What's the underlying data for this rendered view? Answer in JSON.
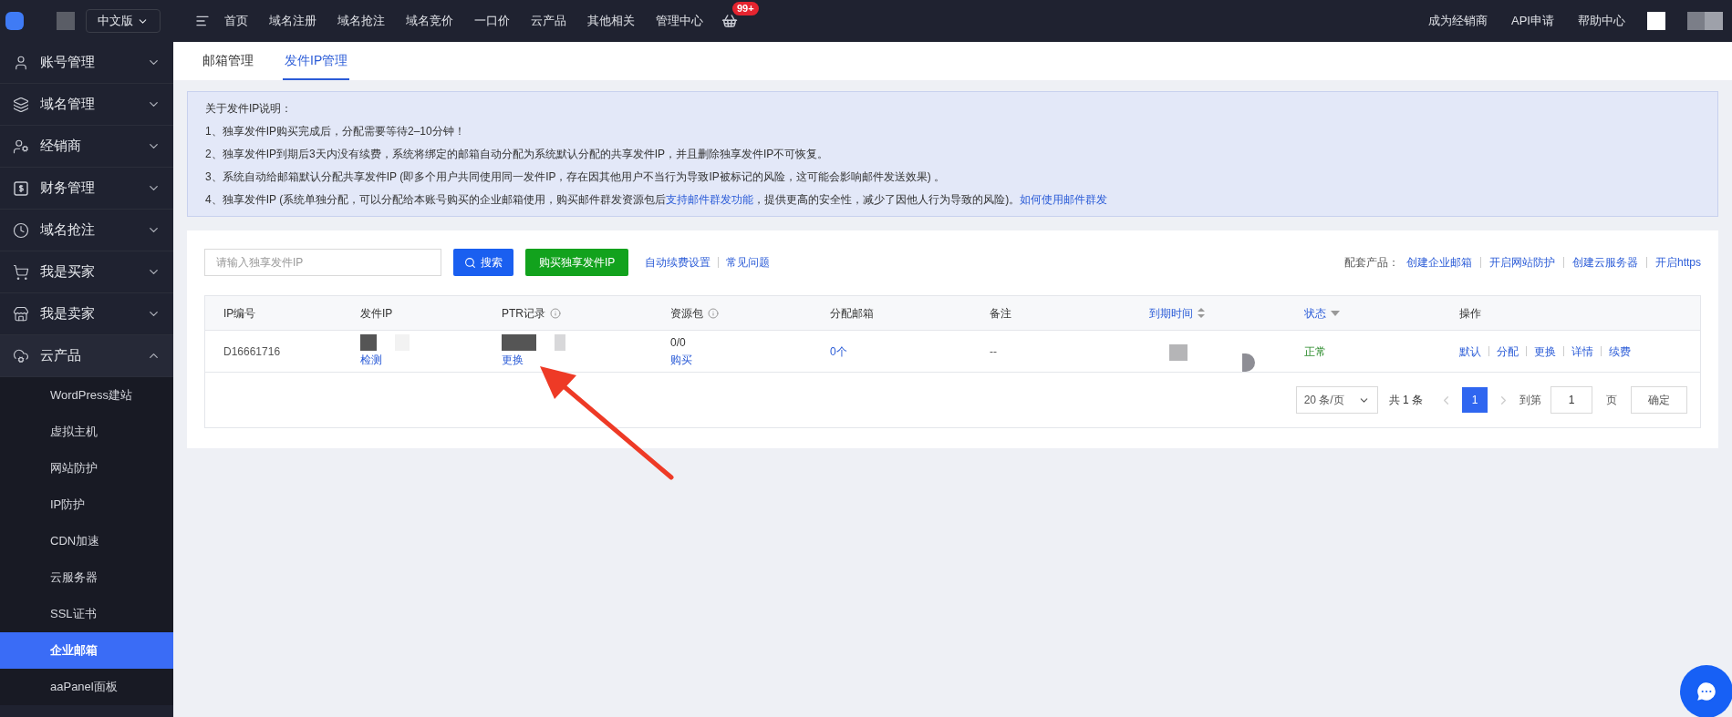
{
  "topbar": {
    "language": "中文版",
    "nav": [
      "首页",
      "域名注册",
      "域名抢注",
      "域名竞价",
      "一口价",
      "云产品",
      "其他相关",
      "管理中心"
    ],
    "cart_badge": "99+",
    "right_links": [
      "成为经销商",
      "API申请",
      "帮助中心"
    ]
  },
  "sidebar": {
    "items": [
      {
        "label": "账号管理",
        "expanded": false
      },
      {
        "label": "域名管理",
        "expanded": false
      },
      {
        "label": "经销商",
        "expanded": false
      },
      {
        "label": "财务管理",
        "expanded": false
      },
      {
        "label": "域名抢注",
        "expanded": false
      },
      {
        "label": "我是买家",
        "expanded": false
      },
      {
        "label": "我是卖家",
        "expanded": false
      },
      {
        "label": "云产品",
        "expanded": true,
        "children": [
          {
            "label": "WordPress建站",
            "selected": false
          },
          {
            "label": "虚拟主机",
            "selected": false
          },
          {
            "label": "网站防护",
            "selected": false
          },
          {
            "label": "IP防护",
            "selected": false
          },
          {
            "label": "CDN加速",
            "selected": false
          },
          {
            "label": "云服务器",
            "selected": false
          },
          {
            "label": "SSL证书",
            "selected": false
          },
          {
            "label": "企业邮箱",
            "selected": true
          },
          {
            "label": "aaPanel面板",
            "selected": false
          }
        ]
      }
    ]
  },
  "tabs": [
    {
      "label": "邮箱管理",
      "selected": false
    },
    {
      "label": "发件IP管理",
      "selected": true
    }
  ],
  "notice": {
    "title": "关于发件IP说明：",
    "lines": [
      [
        {
          "kind": "text",
          "text": "1、独享发件IP购买完成后，分配需要等待2–10分钟！"
        }
      ],
      [
        {
          "kind": "text",
          "text": "2、独享发件IP到期后3天内没有续费，系统将绑定的邮箱自动分配为系统默认分配的共享发件IP，并且删除独享发件IP不可恢复。"
        }
      ],
      [
        {
          "kind": "text",
          "text": "3、系统自动给邮箱默认分配共享发件IP (即多个用户共同使用同一发件IP，存在因其他用户不当行为导致IP被标记的风险，这可能会影响邮件发送效果) 。"
        }
      ],
      [
        {
          "kind": "text",
          "text": "4、独享发件IP (系统单独分配，可以分配给本账号购买的企业邮箱使用，购买邮件群发资源包后"
        },
        {
          "kind": "link",
          "text": "支持邮件群发功能"
        },
        {
          "kind": "text",
          "text": "，提供更高的安全性，减少了因他人行为导致的风险)。"
        },
        {
          "kind": "link",
          "text": "如何使用邮件群发"
        }
      ]
    ]
  },
  "toolbar": {
    "search": {
      "placeholder": "请输入独享发件IP"
    },
    "search_button": "搜索",
    "buy_button": "购买独享发件IP",
    "links": [
      "自动续费设置",
      "常见问题"
    ],
    "related_label": "配套产品：",
    "related_links": [
      "创建企业邮箱",
      "开启网站防护",
      "创建云服务器",
      "开启https"
    ]
  },
  "table": {
    "columns": [
      {
        "label": "IP编号",
        "kind": "plain"
      },
      {
        "label": "发件IP",
        "kind": "plain"
      },
      {
        "label": "PTR记录",
        "kind": "info"
      },
      {
        "label": "资源包",
        "kind": "info"
      },
      {
        "label": "分配邮箱",
        "kind": "plain"
      },
      {
        "label": "备注",
        "kind": "plain"
      },
      {
        "label": "到期时间",
        "kind": "sort"
      },
      {
        "label": "状态",
        "kind": "filter"
      },
      {
        "label": "操作",
        "kind": "plain"
      }
    ],
    "rows": [
      {
        "cells": [
          {
            "kind": "text",
            "text": "D16661716"
          },
          {
            "kind": "redacted_link",
            "link": "检测"
          },
          {
            "kind": "redacted_link",
            "link": "更换"
          },
          {
            "kind": "count_link",
            "text": "0/0",
            "link": "购买"
          },
          {
            "kind": "link",
            "text": "0个"
          },
          {
            "kind": "text",
            "text": "--"
          },
          {
            "kind": "redacted"
          },
          {
            "kind": "status",
            "text": "正常"
          },
          {
            "kind": "actions",
            "links": [
              "默认",
              "分配",
              "更换",
              "详情",
              "续费"
            ]
          }
        ]
      }
    ]
  },
  "pagination": {
    "page_size": "20 条/页",
    "total": "共 1 条",
    "pages": [
      {
        "label": "1",
        "selected": true
      }
    ],
    "goto_label": "到第",
    "goto_value": "1",
    "page_label": "页",
    "confirm": "确定"
  }
}
